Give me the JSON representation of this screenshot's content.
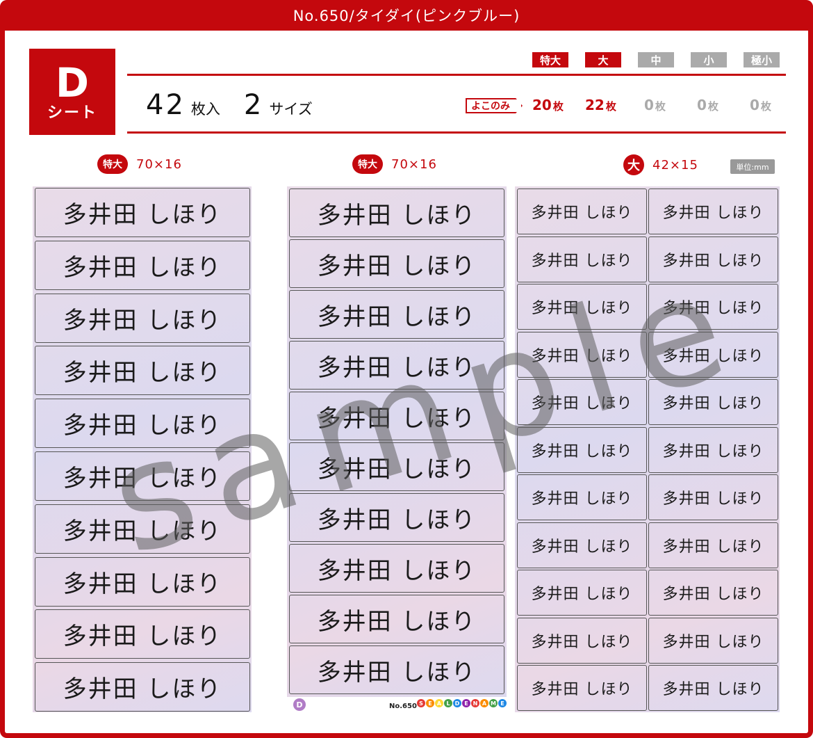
{
  "title": "No.650/タイダイ(ピンクブルー)",
  "sheet_badge": {
    "letter": "D",
    "label": "シート"
  },
  "count": {
    "total": "42",
    "total_unit": "枚入",
    "sizes": "2",
    "sizes_unit": "サイズ"
  },
  "size_tags": [
    {
      "label": "特大",
      "color": "#c4080d"
    },
    {
      "label": "大",
      "color": "#c4080d"
    },
    {
      "label": "中",
      "color": "#aaaaaa"
    },
    {
      "label": "小",
      "color": "#aaaaaa"
    },
    {
      "label": "極小",
      "color": "#aaaaaa"
    }
  ],
  "orientation_label": "よこのみ",
  "quantities": [
    {
      "n": "20",
      "unit": "枚",
      "color": "#c4080d"
    },
    {
      "n": "22",
      "unit": "枚",
      "color": "#c4080d"
    },
    {
      "n": "0",
      "unit": "枚",
      "color": "#aaaaaa"
    },
    {
      "n": "0",
      "unit": "枚",
      "color": "#aaaaaa"
    },
    {
      "n": "0",
      "unit": "枚",
      "color": "#aaaaaa"
    }
  ],
  "columns": [
    {
      "tag": "特大",
      "size": "70×16"
    },
    {
      "tag": "特大",
      "size": "70×16"
    },
    {
      "tag": "大",
      "size": "42×15"
    }
  ],
  "unit_note": "単位:mm",
  "label_text": "多井田 しほり",
  "watermark": "sample",
  "footer": {
    "badge": "D",
    "number": "No.650",
    "logo_letters": [
      "S",
      "E",
      "A",
      "L",
      "D",
      "E",
      "N",
      "A",
      "M",
      "E"
    ]
  },
  "colors": {
    "accent": "#c4080d",
    "inactive": "#aaaaaa"
  }
}
